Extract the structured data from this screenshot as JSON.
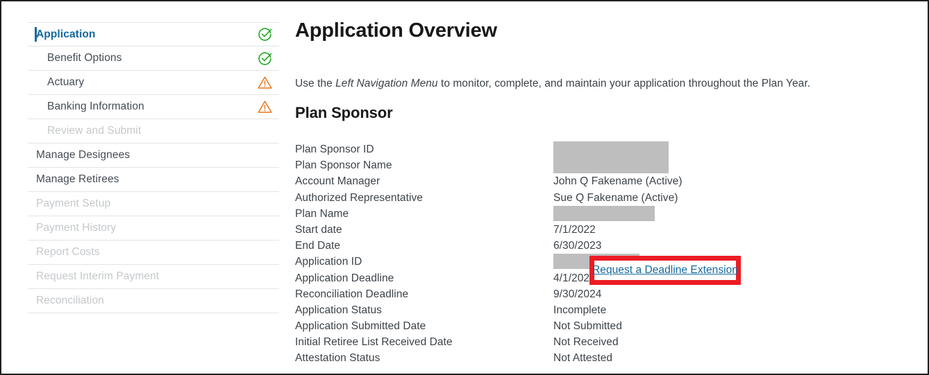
{
  "sidebar": {
    "items": [
      {
        "label": "Application",
        "level": "top",
        "state": "active",
        "status": "check-circle-icon"
      },
      {
        "label": "Benefit Options",
        "level": "sub",
        "state": "enabled",
        "status": "check-circle-icon"
      },
      {
        "label": "Actuary",
        "level": "sub",
        "state": "enabled",
        "status": "warning-triangle-icon"
      },
      {
        "label": "Banking Information",
        "level": "sub",
        "state": "enabled",
        "status": "warning-triangle-icon"
      },
      {
        "label": "Review and Submit",
        "level": "sub",
        "state": "disabled",
        "status": ""
      },
      {
        "label": "Manage Designees",
        "level": "top",
        "state": "enabled",
        "status": ""
      },
      {
        "label": "Manage Retirees",
        "level": "top",
        "state": "enabled",
        "status": ""
      },
      {
        "label": "Payment Setup",
        "level": "top",
        "state": "disabled",
        "status": ""
      },
      {
        "label": "Payment History",
        "level": "top",
        "state": "disabled",
        "status": ""
      },
      {
        "label": "Report Costs",
        "level": "top",
        "state": "disabled",
        "status": ""
      },
      {
        "label": "Request Interim Payment",
        "level": "top",
        "state": "disabled",
        "status": ""
      },
      {
        "label": "Reconciliation",
        "level": "top",
        "state": "disabled",
        "status": ""
      }
    ]
  },
  "main": {
    "page_title": "Application Overview",
    "intro_before": "Use the ",
    "intro_emphasis": "Left Navigation Menu",
    "intro_after": " to monitor, complete, and maintain your application throughout the Plan Year.",
    "section_title": "Plan Sponsor",
    "details": [
      {
        "label": "Plan Sponsor ID",
        "value": "",
        "redacted": "sponsor-id"
      },
      {
        "label": "Plan Sponsor Name",
        "value": "",
        "redacted": "sponsor-name"
      },
      {
        "label": "Account Manager",
        "value": "John Q Fakename (Active)",
        "redacted": ""
      },
      {
        "label": "Authorized Representative",
        "value": "Sue Q Fakename (Active)",
        "redacted": ""
      },
      {
        "label": "Plan Name",
        "value": "",
        "redacted": "plan-name"
      },
      {
        "label": "Start date",
        "value": "7/1/2022",
        "redacted": ""
      },
      {
        "label": "End Date",
        "value": "6/30/2023",
        "redacted": ""
      },
      {
        "label": "Application ID",
        "value": "",
        "redacted": "app-id"
      },
      {
        "label": "Application Deadline",
        "value": "4/1/2022",
        "redacted": ""
      },
      {
        "label": "Reconciliation Deadline",
        "value": "9/30/2024",
        "redacted": ""
      },
      {
        "label": "Application Status",
        "value": "Incomplete",
        "redacted": ""
      },
      {
        "label": "Application Submitted Date",
        "value": "Not Submitted",
        "redacted": ""
      },
      {
        "label": "Initial Retiree List Received Date",
        "value": "Not Received",
        "redacted": ""
      },
      {
        "label": "Attestation Status",
        "value": "Not Attested",
        "redacted": ""
      }
    ],
    "deadline_extension_link": "Request a Deadline Extension"
  },
  "colors": {
    "accent_blue": "#14689e",
    "check_green": "#1ca81c",
    "warning_orange": "#e8761a",
    "highlight_red": "#ec1c24",
    "redaction_gray": "#bebebe",
    "text_gray": "#3c4349",
    "disabled_gray": "#c5c8cb"
  }
}
